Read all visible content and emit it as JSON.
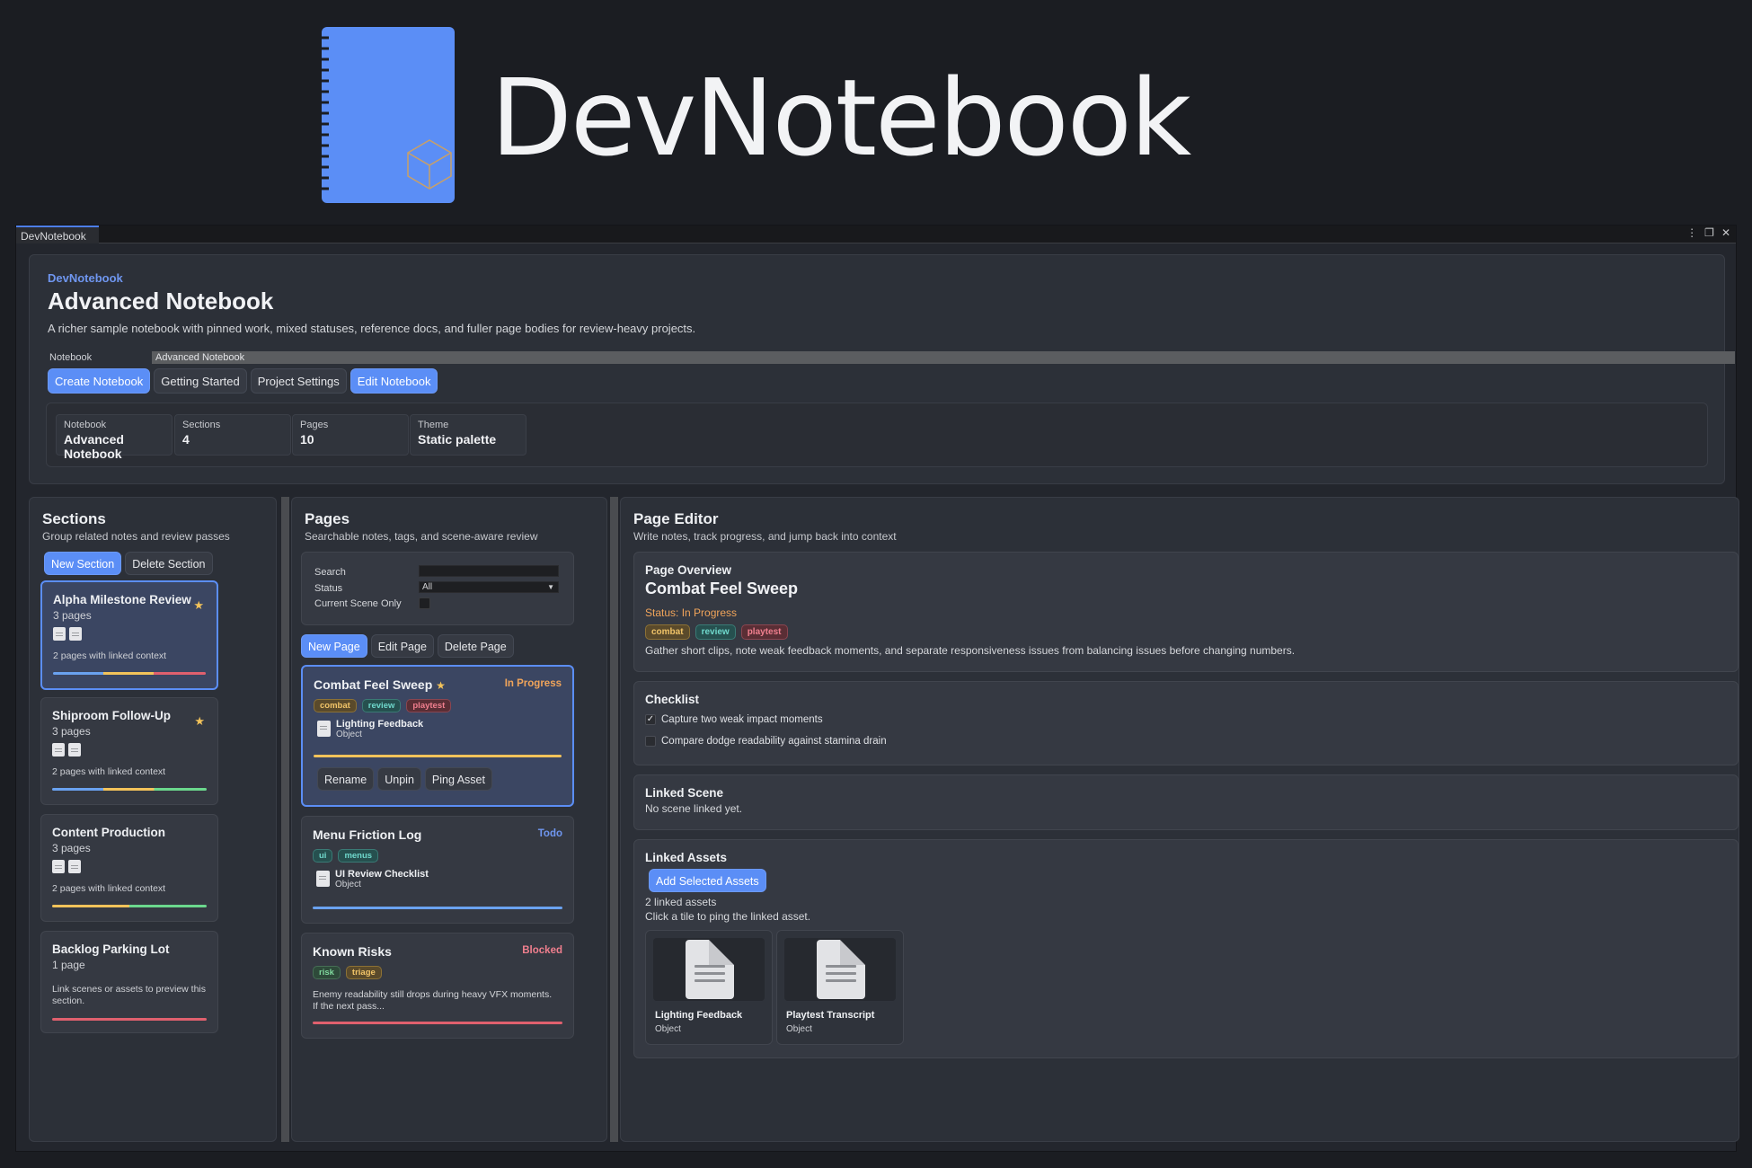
{
  "brand": {
    "title": "DevNotebook"
  },
  "window": {
    "tab": "DevNotebook",
    "controls": {
      "menu": "⋮",
      "maximize": "❐",
      "close": "✕"
    }
  },
  "header": {
    "app_label": "DevNotebook",
    "title": "Advanced Notebook",
    "description": "A richer sample notebook with pinned work, mixed statuses, reference docs, and fuller page bodies for review-heavy projects.",
    "notebook_label": "Notebook",
    "notebook_value": "Advanced Notebook",
    "buttons": {
      "create": "Create Notebook",
      "getting_started": "Getting Started",
      "project_settings": "Project Settings",
      "edit": "Edit Notebook"
    },
    "stats": [
      {
        "key": "Notebook",
        "value": "Advanced Notebook"
      },
      {
        "key": "Sections",
        "value": "4"
      },
      {
        "key": "Pages",
        "value": "10"
      },
      {
        "key": "Theme",
        "value": "Static palette"
      }
    ]
  },
  "sections": {
    "title": "Sections",
    "subtitle": "Group related notes and review passes",
    "new_button": "New Section",
    "delete_button": "Delete Section",
    "items": [
      {
        "title": "Alpha Milestone Review",
        "pages": "3 pages",
        "context": "2 pages with linked context",
        "star": "★"
      },
      {
        "title": "Shiproom Follow-Up",
        "pages": "3 pages",
        "context": "2 pages with linked context",
        "star": "★"
      },
      {
        "title": "Content Production",
        "pages": "3 pages",
        "context": "2 pages with linked context"
      },
      {
        "title": "Backlog Parking Lot",
        "pages": "1 page",
        "context": "Link scenes or assets to preview this section."
      }
    ]
  },
  "pages": {
    "title": "Pages",
    "subtitle": "Searchable notes, tags, and scene-aware review",
    "filters": {
      "search_label": "Search",
      "search_value": "",
      "status_label": "Status",
      "status_value": "All",
      "scene_label": "Current Scene Only"
    },
    "new_button": "New Page",
    "edit_button": "Edit Page",
    "delete_button": "Delete Page",
    "items": [
      {
        "title": "Combat Feel Sweep",
        "star": "★",
        "status": "In Progress",
        "status_color": "#f0a45a",
        "tags": [
          "combat",
          "review",
          "playtest"
        ],
        "asset_name": "Lighting Feedback",
        "asset_type": "Object",
        "actions": {
          "rename": "Rename",
          "unpin": "Unpin",
          "ping": "Ping Asset"
        }
      },
      {
        "title": "Menu Friction Log",
        "status": "Todo",
        "status_color": "#6f96f0",
        "tags": [
          "ui",
          "menus"
        ],
        "asset_name": "UI Review Checklist",
        "asset_type": "Object"
      },
      {
        "title": "Known Risks",
        "status": "Blocked",
        "status_color": "#f07f8e",
        "tags": [
          "risk",
          "triage"
        ],
        "snippet": "Enemy readability still drops during heavy VFX moments. If the next pass..."
      }
    ]
  },
  "editor": {
    "title": "Page Editor",
    "subtitle": "Write notes, track progress, and jump back into context",
    "overview": {
      "heading": "Page Overview",
      "page_title": "Combat Feel Sweep",
      "status": "Status: In Progress",
      "tags": [
        "combat",
        "review",
        "playtest"
      ],
      "description": "Gather short clips, note weak feedback moments, and separate responsiveness issues from balancing issues before changing numbers."
    },
    "checklist": {
      "heading": "Checklist",
      "items": [
        {
          "label": "Capture two weak impact moments",
          "checked": true,
          "mark": "✓"
        },
        {
          "label": "Compare dodge readability against stamina drain",
          "checked": false,
          "mark": ""
        }
      ]
    },
    "linked_scene": {
      "heading": "Linked Scene",
      "value": "No scene linked yet."
    },
    "linked_assets": {
      "heading": "Linked Assets",
      "add_button": "Add Selected Assets",
      "count": "2 linked assets",
      "hint": "Click a tile to ping the linked asset.",
      "tiles": [
        {
          "name": "Lighting Feedback",
          "type": "Object"
        },
        {
          "name": "Playtest Transcript",
          "type": "Object"
        }
      ]
    }
  },
  "colors": {
    "accent": "#5b8ef6",
    "amber": "#f3c35a",
    "green": "#6bd88d",
    "red": "#e0606e",
    "blue": "#6aa2f0"
  }
}
